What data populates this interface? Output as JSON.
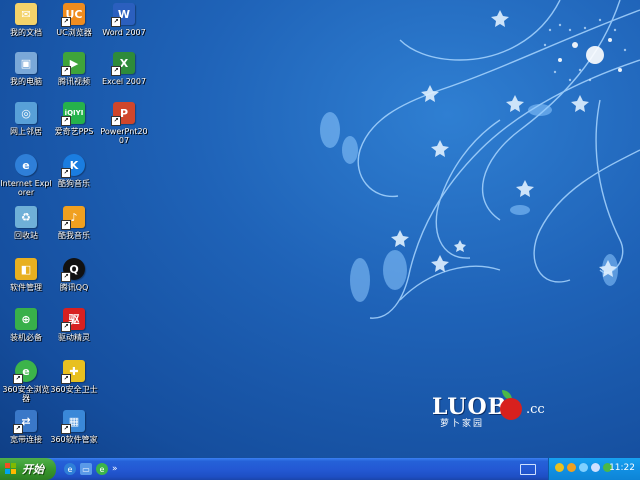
{
  "desktop": {
    "icons": [
      {
        "label": "我的文档",
        "icon": "my-documents-icon",
        "color": "#f4d36a"
      },
      {
        "label": "UC浏览器",
        "icon": "uc-browser-icon",
        "color": "#f08c1e"
      },
      {
        "label": "Word 2007",
        "icon": "word-icon",
        "color": "#2b5fbe"
      },
      {
        "label": "我的电脑",
        "icon": "my-computer-icon",
        "color": "#7aa8d8"
      },
      {
        "label": "腾讯视频",
        "icon": "tencent-video-icon",
        "color": "#3fa43a"
      },
      {
        "label": "Excel 2007",
        "icon": "excel-icon",
        "color": "#2e8b3a"
      },
      {
        "label": "网上邻居",
        "icon": "network-icon",
        "color": "#58a0d8"
      },
      {
        "label": "爱奇艺PPS",
        "icon": "iqiyi-icon",
        "color": "#26b24b"
      },
      {
        "label": "PowerPnt2007",
        "icon": "powerpoint-icon",
        "color": "#d0462b"
      },
      {
        "label": "Internet Explorer",
        "icon": "ie-icon",
        "color": "#2f7fd8"
      },
      {
        "label": "酷狗音乐",
        "icon": "kugou-icon",
        "color": "#1a7de0"
      },
      {
        "label": "回收站",
        "icon": "recycle-bin-icon",
        "color": "#6fb0d8"
      },
      {
        "label": "酷我音乐",
        "icon": "kuwo-icon",
        "color": "#f0a020"
      },
      {
        "label": "软件管理",
        "icon": "software-manager-icon",
        "color": "#e8b020"
      },
      {
        "label": "腾讯QQ",
        "icon": "qq-icon",
        "color": "#111111"
      },
      {
        "label": "装机必备",
        "icon": "essentials-icon",
        "color": "#38b04a"
      },
      {
        "label": "驱动精灵",
        "icon": "driver-genius-icon",
        "color": "#d82020"
      },
      {
        "label": "360安全浏览器",
        "icon": "360-browser-icon",
        "color": "#3cb44a"
      },
      {
        "label": "360安全卫士",
        "icon": "360-security-icon",
        "color": "#e8c020"
      },
      {
        "label": "宽带连接",
        "icon": "broadband-icon",
        "color": "#3a78c8"
      },
      {
        "label": "360软件管家",
        "icon": "360-software-icon",
        "color": "#3a88d8"
      }
    ]
  },
  "logo": {
    "brand": "LUOB",
    "suffix": ".cc",
    "sub": "萝卜家园"
  },
  "taskbar": {
    "start_label": "开始",
    "quick_launch_more": "»",
    "clock": "11:22"
  }
}
